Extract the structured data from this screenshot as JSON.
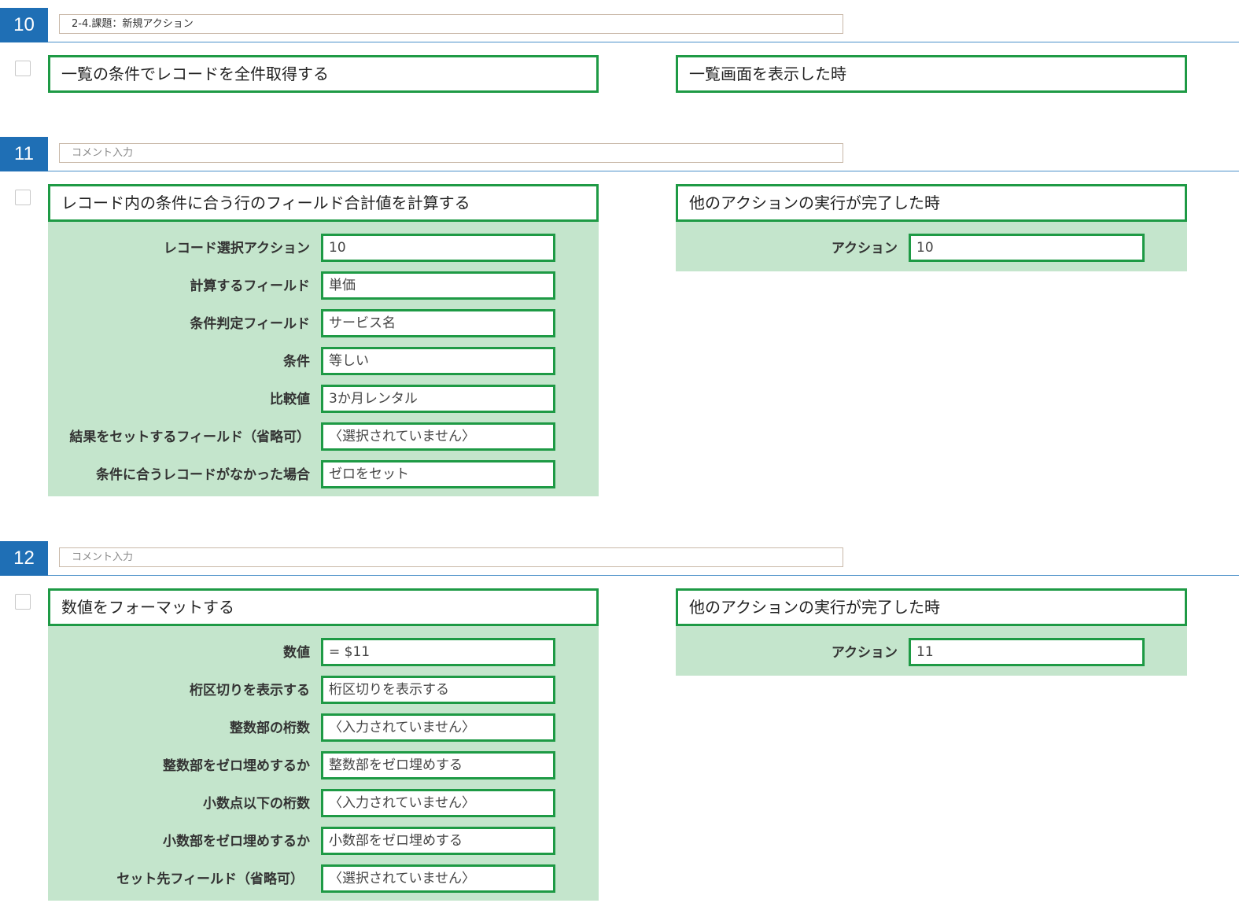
{
  "steps": [
    {
      "number": "10",
      "comment": "2-4.課題：新規アクション",
      "action": {
        "title": "一覧の条件でレコードを全件取得する",
        "fields": []
      },
      "trigger": {
        "title": "一覧画面を表示した時",
        "fields": []
      }
    },
    {
      "number": "11",
      "comment": "コメント入力",
      "action": {
        "title": "レコード内の条件に合う行のフィールド合計値を計算する",
        "fields": [
          {
            "label": "レコード選択アクション",
            "value": "10"
          },
          {
            "label": "計算するフィールド",
            "value": "単価"
          },
          {
            "label": "条件判定フィールド",
            "value": "サービス名"
          },
          {
            "label": "条件",
            "value": "等しい"
          },
          {
            "label": "比較値",
            "value": "3か月レンタル"
          },
          {
            "label": "結果をセットするフィールド（省略可）",
            "value": "〈選択されていません〉"
          },
          {
            "label": "条件に合うレコードがなかった場合",
            "value": "ゼロをセット"
          }
        ]
      },
      "trigger": {
        "title": "他のアクションの実行が完了した時",
        "fields": [
          {
            "label": "アクション",
            "value": "10"
          }
        ]
      }
    },
    {
      "number": "12",
      "comment": "コメント入力",
      "action": {
        "title": "数値をフォーマットする",
        "fields": [
          {
            "label": "数値",
            "value": "= $11"
          },
          {
            "label": "桁区切りを表示する",
            "value": "桁区切りを表示する"
          },
          {
            "label": "整数部の桁数",
            "value": "〈入力されていません〉"
          },
          {
            "label": "整数部をゼロ埋めするか",
            "value": "整数部をゼロ埋めする"
          },
          {
            "label": "小数点以下の桁数",
            "value": "〈入力されていません〉"
          },
          {
            "label": "小数部をゼロ埋めするか",
            "value": "小数部をゼロ埋めする"
          },
          {
            "label": "セット先フィールド（省略可）",
            "value": "〈選択されていません〉"
          }
        ]
      },
      "trigger": {
        "title": "他のアクションの実行が完了した時",
        "fields": [
          {
            "label": "アクション",
            "value": "11"
          }
        ]
      }
    }
  ],
  "colors": {
    "step_badge": "#1f6fb5",
    "panel_border": "#1e9a45",
    "panel_fill": "#c4e5cc"
  }
}
